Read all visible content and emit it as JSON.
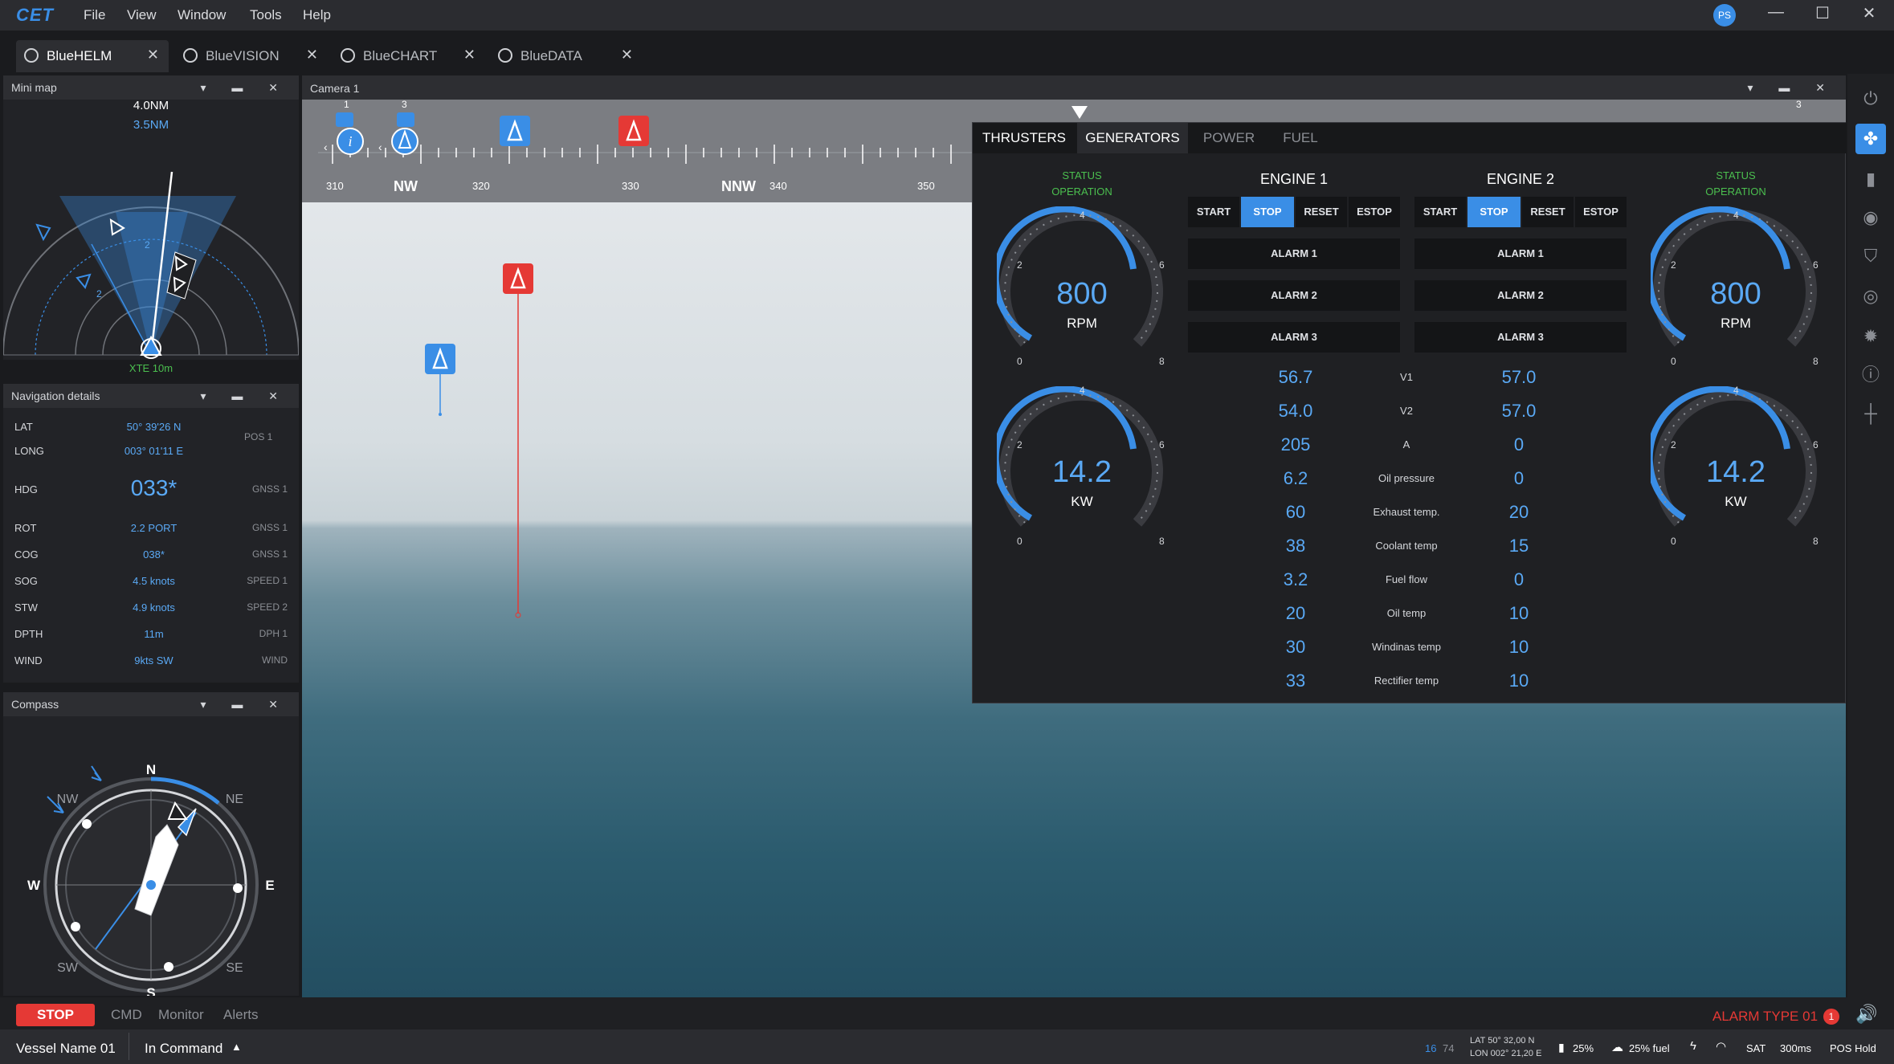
{
  "app": {
    "logo": "CET",
    "menu": [
      "File",
      "View",
      "Window",
      "Tools",
      "Help"
    ],
    "avatar": "PS",
    "window_controls": [
      "—",
      "☐",
      "✕"
    ]
  },
  "tabs": [
    {
      "label": "BlueHELM"
    },
    {
      "label": "BlueVISION"
    },
    {
      "label": "BlueCHART"
    },
    {
      "label": "BlueDATA"
    }
  ],
  "minimap": {
    "title": "Mini map",
    "range_outer": "4.0NM",
    "range_inner": "3.5NM",
    "xte": "XTE 10m",
    "markers": [
      "2",
      "2"
    ]
  },
  "navdetails": {
    "title": "Navigation details",
    "rows": [
      {
        "label": "LAT",
        "value": "50° 39'26 N",
        "source": ""
      },
      {
        "label": "LONG",
        "value": "003° 01'11 E",
        "source": "POS 1"
      },
      {
        "label": "HDG",
        "value": "033*",
        "source": "GNSS 1"
      },
      {
        "label": "ROT",
        "value": "2.2 PORT",
        "source": "GNSS 1"
      },
      {
        "label": "COG",
        "value": "038*",
        "source": "GNSS 1"
      },
      {
        "label": "SOG",
        "value": "4.5 knots",
        "source": "SPEED 1"
      },
      {
        "label": "STW",
        "value": "4.9 knots",
        "source": "SPEED 2"
      },
      {
        "label": "DPTH",
        "value": "11m",
        "source": "DPH 1"
      },
      {
        "label": "WIND",
        "value": "9kts SW",
        "source": "WIND"
      }
    ]
  },
  "compass": {
    "title": "Compass",
    "labels": {
      "n": "N",
      "ne": "NE",
      "e": "E",
      "se": "SE",
      "s": "S",
      "sw": "SW",
      "w": "W",
      "nw": "NW"
    }
  },
  "camera": {
    "title": "Camera 1",
    "strip_labels": [
      {
        "t": "310"
      },
      {
        "t": "NW"
      },
      {
        "t": "320"
      },
      {
        "t": "330"
      },
      {
        "t": "NNW"
      },
      {
        "t": "340"
      },
      {
        "t": "350"
      }
    ],
    "markers": [
      "1",
      "3",
      "3"
    ]
  },
  "engine": {
    "tabs": [
      "THRUSTERS",
      "GENERATORS",
      "POWER",
      "FUEL"
    ],
    "status_label": "STATUS",
    "status_value": "OPERATION",
    "engine1": "ENGINE 1",
    "engine2": "ENGINE 2",
    "buttons": [
      "START",
      "STOP",
      "RESET",
      "ESTOP"
    ],
    "alarms": [
      "ALARM 1",
      "ALARM 2",
      "ALARM 3"
    ],
    "rpm_value": "800",
    "rpm_unit": "RPM",
    "kw_value": "14.2",
    "kw_unit": "KW",
    "gauge_ticks": [
      "0",
      "2",
      "4",
      "6",
      "8"
    ],
    "metrics": [
      {
        "label": "V1",
        "e1": "56.7",
        "e2": "57.0"
      },
      {
        "label": "V2",
        "e1": "54.0",
        "e2": "57.0"
      },
      {
        "label": "A",
        "e1": "205",
        "e2": "0"
      },
      {
        "label": "Oil pressure",
        "e1": "6.2",
        "e2": "0"
      },
      {
        "label": "Exhaust temp.",
        "e1": "60",
        "e2": "20"
      },
      {
        "label": "Coolant temp",
        "e1": "38",
        "e2": "15"
      },
      {
        "label": "Fuel flow",
        "e1": "3.2",
        "e2": "0"
      },
      {
        "label": "Oil temp",
        "e1": "20",
        "e2": "10"
      },
      {
        "label": "Windinas temp",
        "e1": "30",
        "e2": "10"
      },
      {
        "label": "Rectifier temp",
        "e1": "33",
        "e2": "10"
      }
    ]
  },
  "bottom": {
    "stop": "STOP",
    "tabs": [
      "CMD",
      "Monitor",
      "Alerts"
    ],
    "alarm": "ALARM TYPE 01",
    "alarm_count": "1"
  },
  "status": {
    "vessel": "Vessel Name 01",
    "command": "In Command",
    "sats": "16",
    "sats2": "74",
    "lat": "LAT 50° 32,00 N",
    "lon": "LON 002° 21,20 E",
    "battery": "25%",
    "fuel": "25% fuel",
    "sat": "SAT",
    "latency": "300ms",
    "pos": "POS Hold"
  },
  "colors": {
    "accent": "#3a8ee6",
    "alarm": "#e53935",
    "status_ok": "#4bbf4f"
  }
}
